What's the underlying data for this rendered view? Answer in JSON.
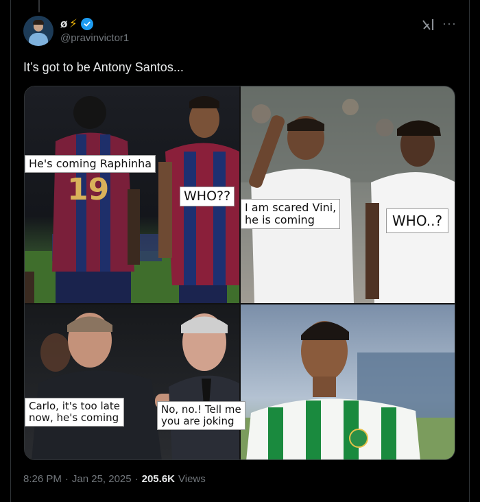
{
  "tweet": {
    "display_name": "ø",
    "display_emoji": "⚡",
    "handle": "@pravinvictor1",
    "text": "It’s got to be Antony Santos...",
    "time": "8:26 PM",
    "date": "Jan 25, 2025",
    "views_count": "205.6K",
    "views_label": "Views",
    "separator": "·"
  },
  "icons": {
    "verified": "verified-badge-icon",
    "grok": "grok-icon",
    "more": "more-dots-icon",
    "more_glyph": "···"
  },
  "meme": {
    "captions": [
      "He's coming Raphinha",
      "WHO??",
      "I am scared Vini,\nhe is coming",
      "WHO..?",
      "Carlo, it's too late\nnow, he's coming",
      "No, no.! Tell me\nyou are joking"
    ],
    "jersey_number": "19"
  },
  "colors": {
    "background": "#000000",
    "text_primary": "#e7e9ea",
    "text_secondary": "#71767b",
    "verified_blue": "#1d9bf0",
    "bolt_yellow": "#f5b90a"
  }
}
